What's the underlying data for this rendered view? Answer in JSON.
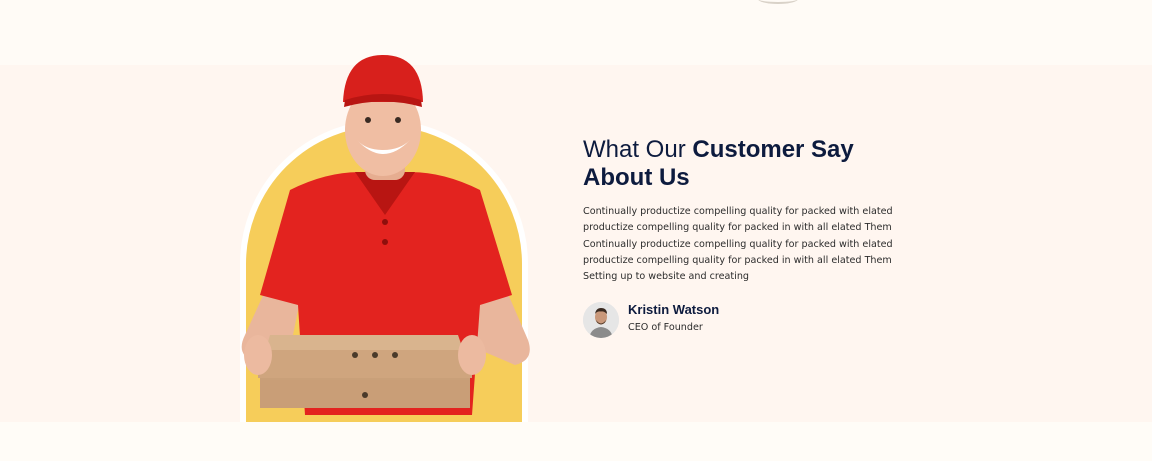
{
  "testimonial": {
    "heading_light": "What Our ",
    "heading_bold_1": "Customer Say",
    "heading_bold_2": "About Us",
    "description_lines": [
      "Continually productize compelling quality for packed with elated",
      "productize compelling quality for packed in with all elated Them",
      "Continually productize compelling quality for packed with elated",
      "productize compelling quality for packed in with all elated Them",
      "Setting up to website and creating"
    ],
    "author": {
      "name": "Kristin Watson",
      "role": "CEO of Founder"
    }
  },
  "colors": {
    "heading": "#0d1b3e",
    "accent_yellow": "#f6cd5a",
    "shirt_red": "#e3231f",
    "box_kraft": "#d2ad85"
  }
}
